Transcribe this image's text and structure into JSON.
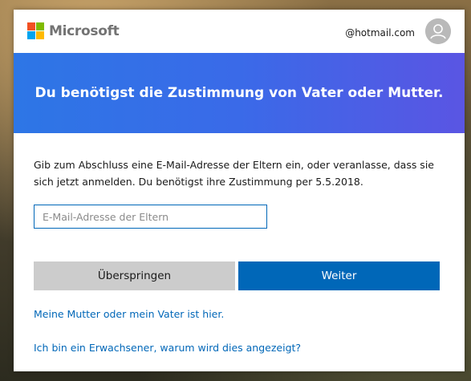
{
  "brand": {
    "name": "Microsoft",
    "colors": {
      "red": "#f25022",
      "green": "#7fba00",
      "blue": "#00a4ef",
      "yellow": "#ffb900"
    }
  },
  "header": {
    "account_email": "@hotmail.com",
    "avatar_icon": "user-avatar-icon"
  },
  "banner": {
    "title": "Du benötigst die Zustimmung von Vater oder Mutter.",
    "gradient": [
      "#2d76e6",
      "#5a55e3"
    ]
  },
  "content": {
    "instructions": "Gib zum Abschluss eine E-Mail-Adresse der Eltern ein, oder veranlasse, dass sie sich jetzt anmelden. Du benötigst ihre Zustimmung per 5.5.2018.",
    "email_field": {
      "value": "",
      "placeholder": "E-Mail-Adresse der Eltern"
    }
  },
  "actions": {
    "skip_label": "Überspringen",
    "next_label": "Weiter",
    "primary_color": "#0067b8"
  },
  "links": {
    "parent_here": "Meine Mutter oder mein Vater ist hier.",
    "why_shown": "Ich bin ein Erwachsener, warum wird dies angezeigt?"
  }
}
